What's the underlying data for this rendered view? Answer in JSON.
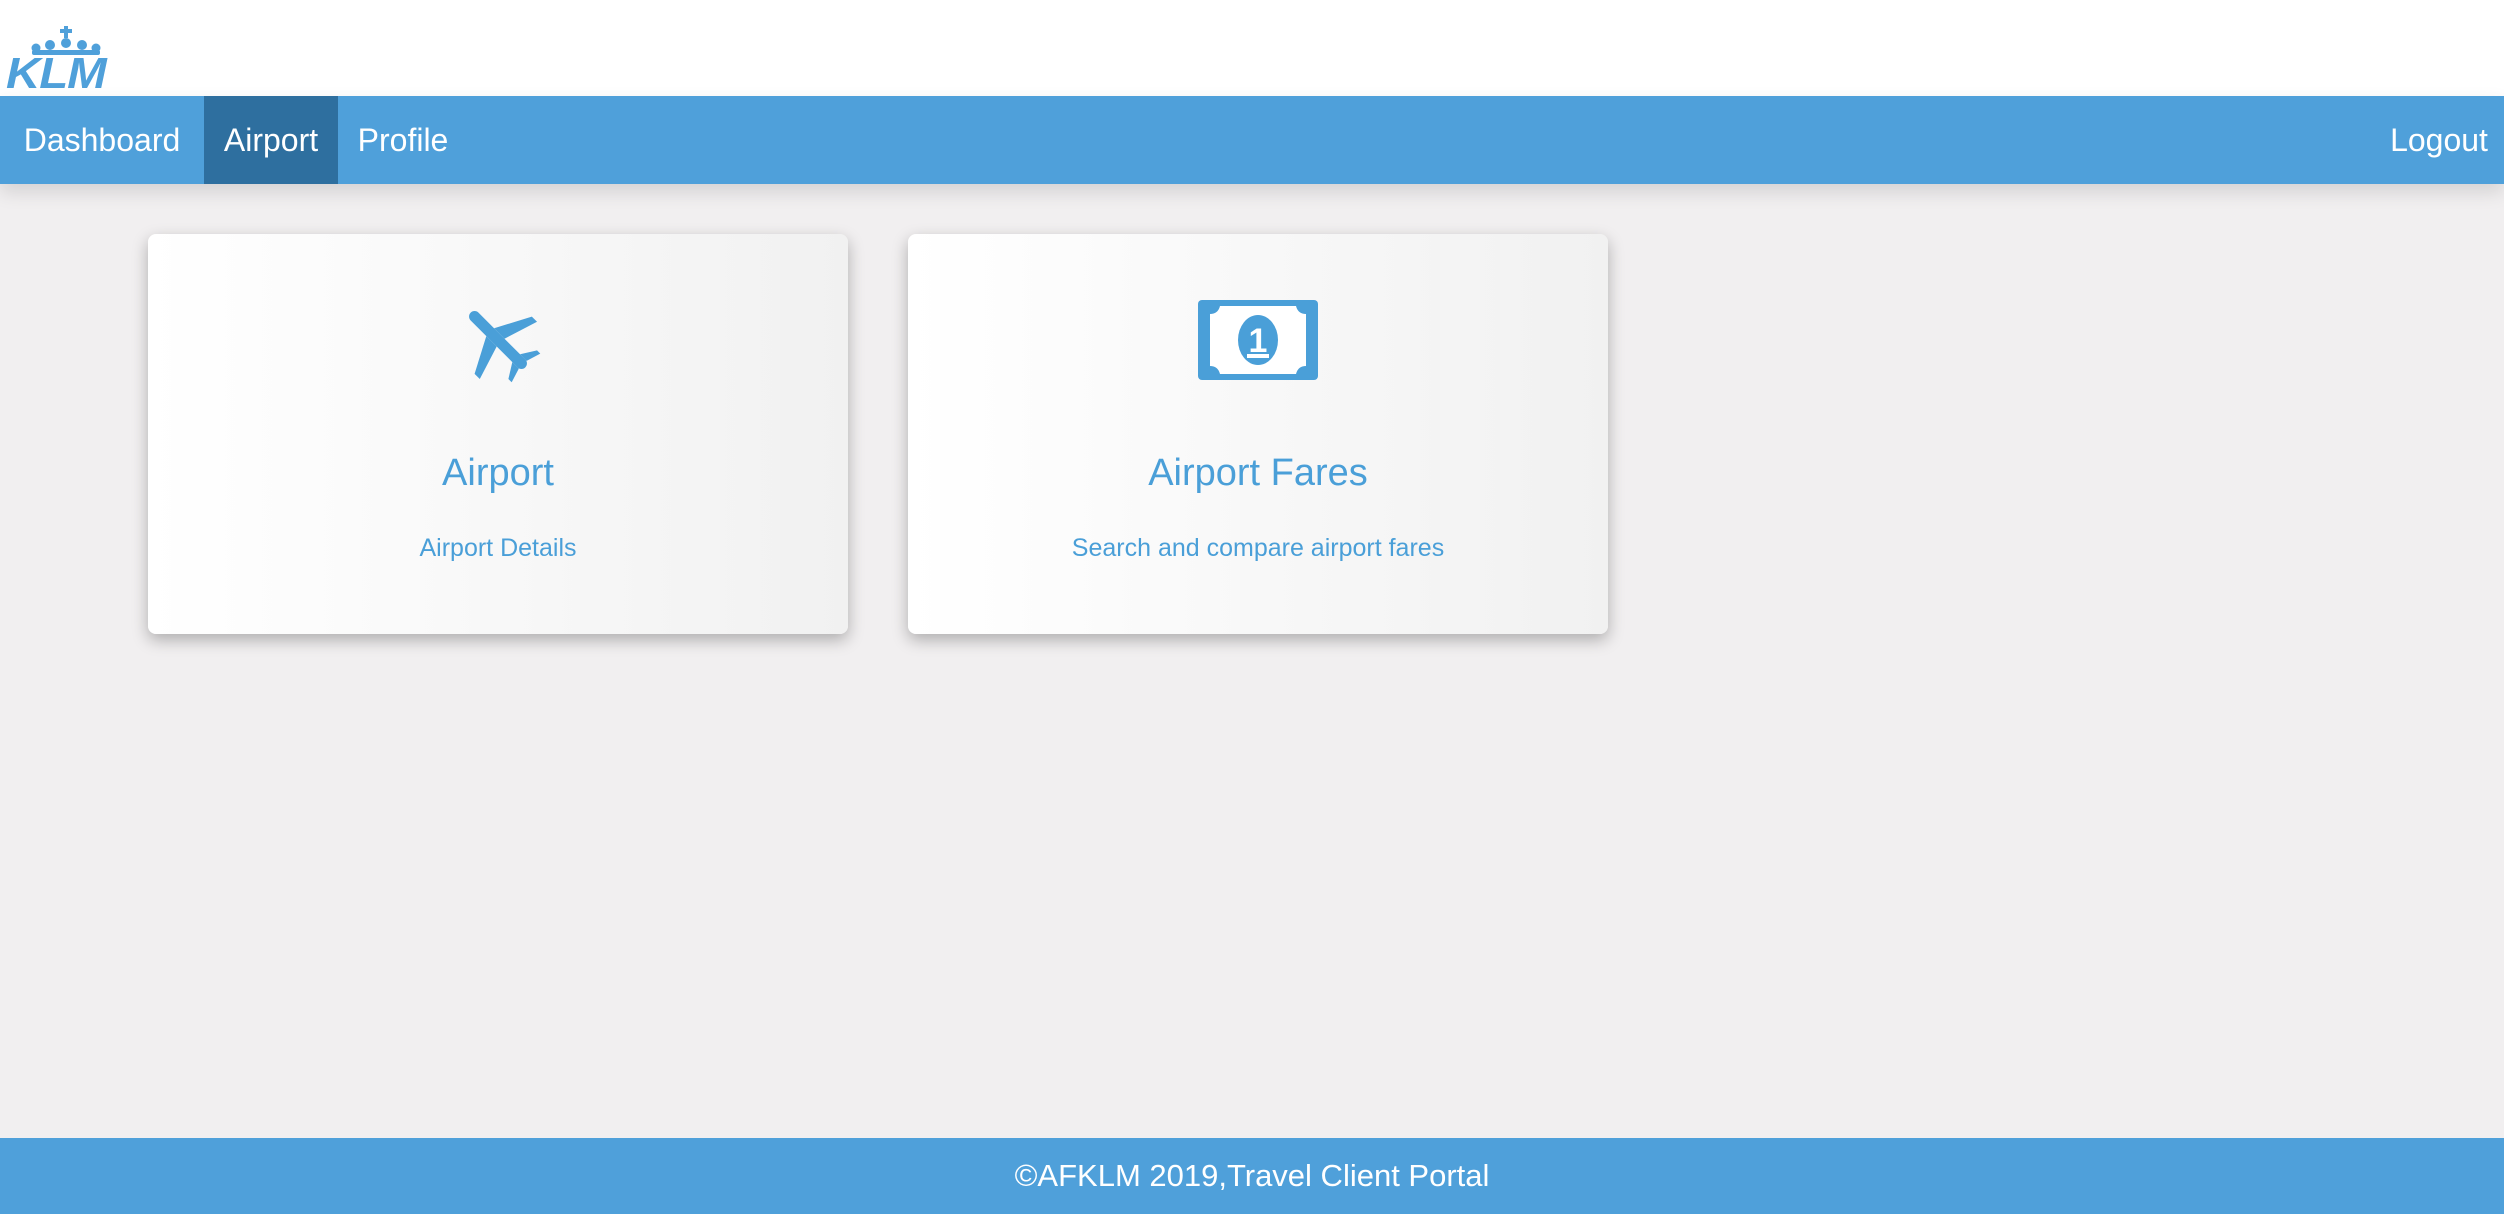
{
  "brand": {
    "logo_text": "KLM",
    "color": "#4fa0da"
  },
  "nav": {
    "items": [
      {
        "label": "Dashboard",
        "active": false
      },
      {
        "label": "Airport",
        "active": true
      },
      {
        "label": "Profile",
        "active": false
      }
    ],
    "logout_label": "Logout",
    "active_color": "#2e6f9f"
  },
  "cards": [
    {
      "title": "Airport",
      "description": "Airport Details",
      "icon": "airplane-icon"
    },
    {
      "title": "Airport Fares",
      "description": "Search and compare airport fares",
      "icon": "money-bill-icon"
    }
  ],
  "footer": {
    "text": "©AFKLM 2019,Travel Client Portal"
  }
}
